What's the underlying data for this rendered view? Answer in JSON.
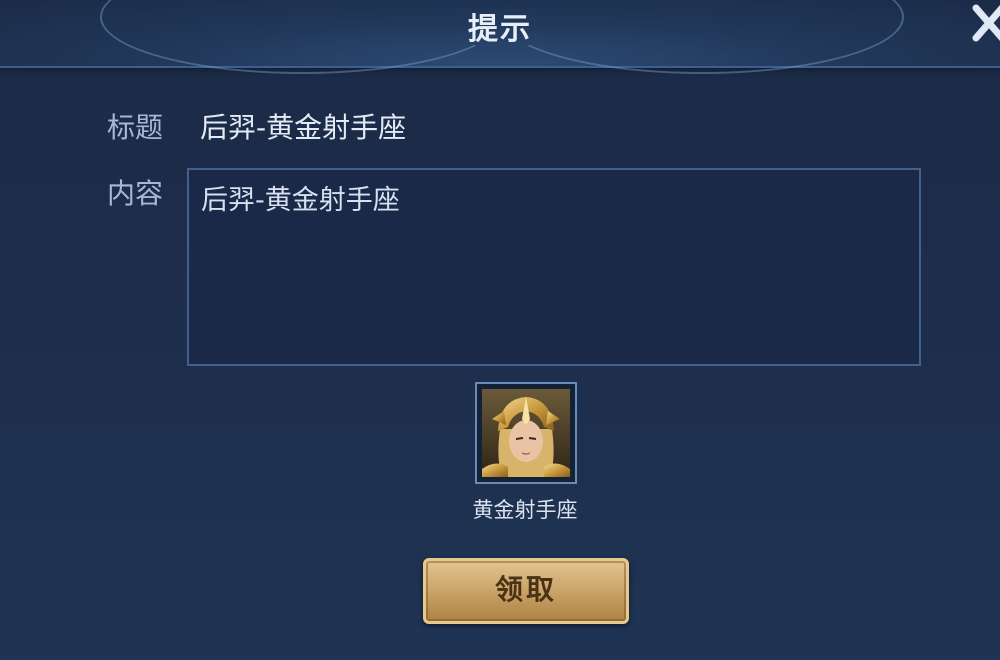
{
  "header": {
    "title": "提示"
  },
  "mail": {
    "title_label": "标题",
    "title_value": "后羿-黄金射手座",
    "content_label": "内容",
    "content_value": "后羿-黄金射手座"
  },
  "reward": {
    "name": "黄金射手座",
    "icon": "hero-skin-portrait-icon"
  },
  "actions": {
    "claim_label": "领取"
  },
  "colors": {
    "background": "#1d2d4b",
    "border": "#42608a",
    "button_gold": "#c8a064",
    "button_text": "#4a3216",
    "label_text": "#a8b8d4"
  }
}
